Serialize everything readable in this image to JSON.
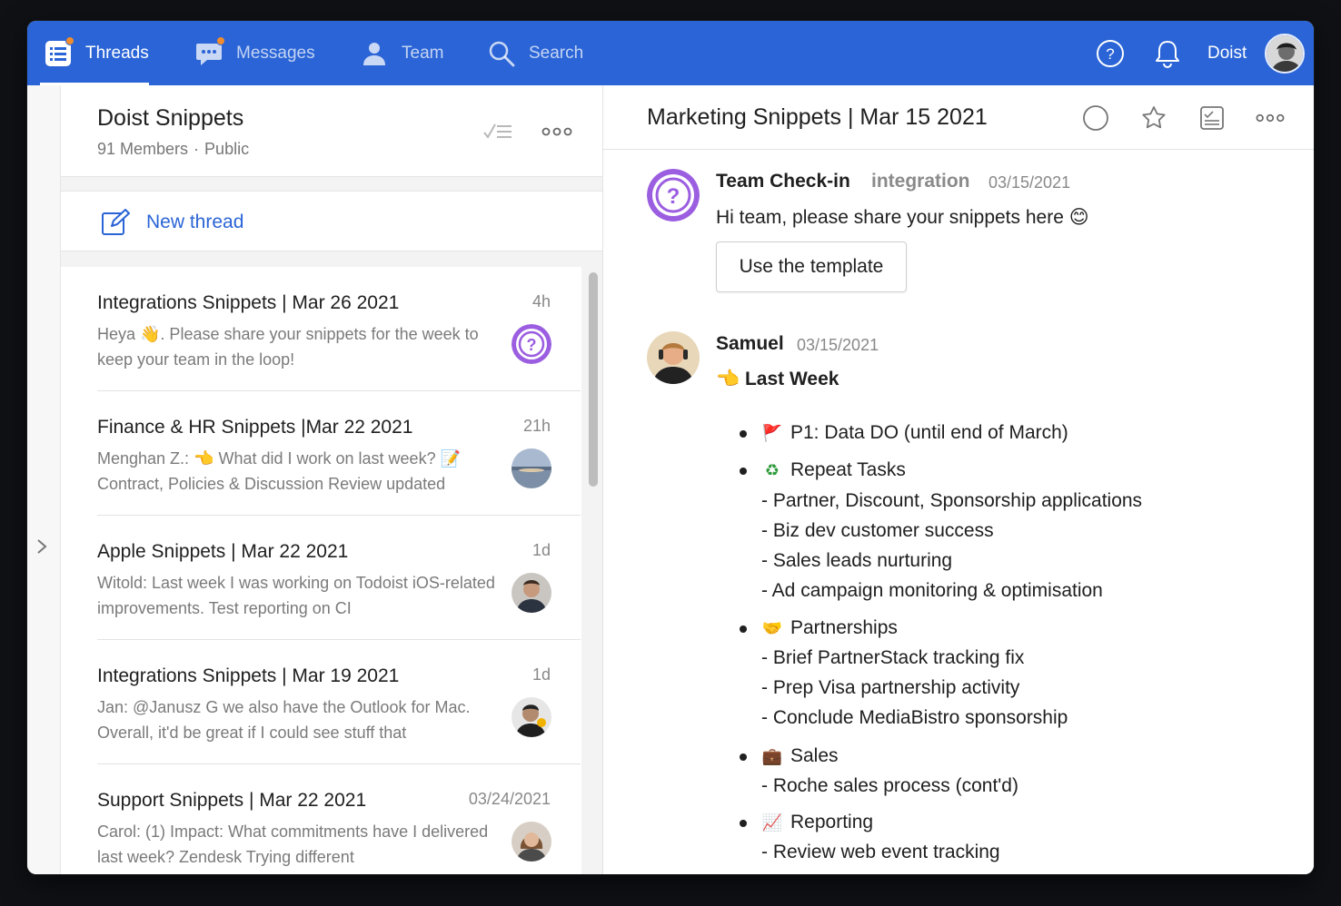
{
  "nav": {
    "tabs": [
      {
        "label": "Threads",
        "icon": "threads-icon",
        "active": true,
        "badge": true
      },
      {
        "label": "Messages",
        "icon": "messages-icon",
        "active": false,
        "badge": true
      },
      {
        "label": "Team",
        "icon": "team-icon",
        "active": false,
        "badge": false
      },
      {
        "label": "Search",
        "icon": "search-icon",
        "active": false,
        "badge": false
      }
    ],
    "user_name": "Doist",
    "accent_color": "#2a64d6",
    "badge_color": "#f08c2e"
  },
  "channel": {
    "title": "Doist Snippets",
    "members": "91 Members",
    "visibility": "Public",
    "new_thread_label": "New thread"
  },
  "threads": [
    {
      "title": "Integrations Snippets | Mar 26 2021",
      "time": "4h",
      "preview": "Heya 👋. Please share your snippets for the week to keep your team in the loop!",
      "avatar": "question-bot"
    },
    {
      "title": "Finance & HR Snippets |Mar 22 2021",
      "time": "21h",
      "preview": "Menghan Z.: 👈 What did I work on last week? 📝 Contract, Policies & Discussion Review updated",
      "avatar": "landscape"
    },
    {
      "title": "Apple Snippets | Mar 22 2021",
      "time": "1d",
      "preview": "Witold: Last week I was working on Todoist iOS-related improvements. Test reporting on CI",
      "avatar": "person"
    },
    {
      "title": "Integrations Snippets | Mar 19 2021",
      "time": "1d",
      "preview": "Jan: @Janusz G we also have the Outlook for Mac. Overall, it'd be great if I could see stuff that",
      "avatar": "person"
    },
    {
      "title": "Support Snippets | Mar 22 2021",
      "time": "03/24/2021",
      "preview": "Carol: (1) Impact: What commitments have I delivered last week? Zendesk Trying different",
      "avatar": "person"
    }
  ],
  "conversation": {
    "title": "Marketing Snippets | Mar 15 2021",
    "messages": [
      {
        "author": "Team Check-in",
        "tag": "integration",
        "date": "03/15/2021",
        "text": "Hi team, please share your snippets here 😊",
        "button": "Use the template"
      },
      {
        "author": "Samuel",
        "date": "03/15/2021",
        "heading": "👈 Last Week"
      }
    ],
    "sections": [
      {
        "emoji": "🚩",
        "label": "P1: Data DO (until end of March)",
        "items": []
      },
      {
        "emoji": "♻",
        "label": "Repeat Tasks",
        "items": [
          "- Partner, Discount, Sponsorship applications",
          "- Biz dev customer success",
          "- Sales leads nurturing",
          "- Ad campaign monitoring & optimisation"
        ]
      },
      {
        "emoji": "🤝",
        "label": "Partnerships",
        "items": [
          "- Brief PartnerStack tracking fix",
          "- Prep Visa partnership activity",
          "- Conclude MediaBistro sponsorship"
        ]
      },
      {
        "emoji": "💼",
        "label": "Sales",
        "items": [
          "- Roche sales process (cont'd)"
        ]
      },
      {
        "emoji": "📈",
        "label": "Reporting",
        "items": [
          "- Review web event tracking"
        ]
      }
    ]
  }
}
